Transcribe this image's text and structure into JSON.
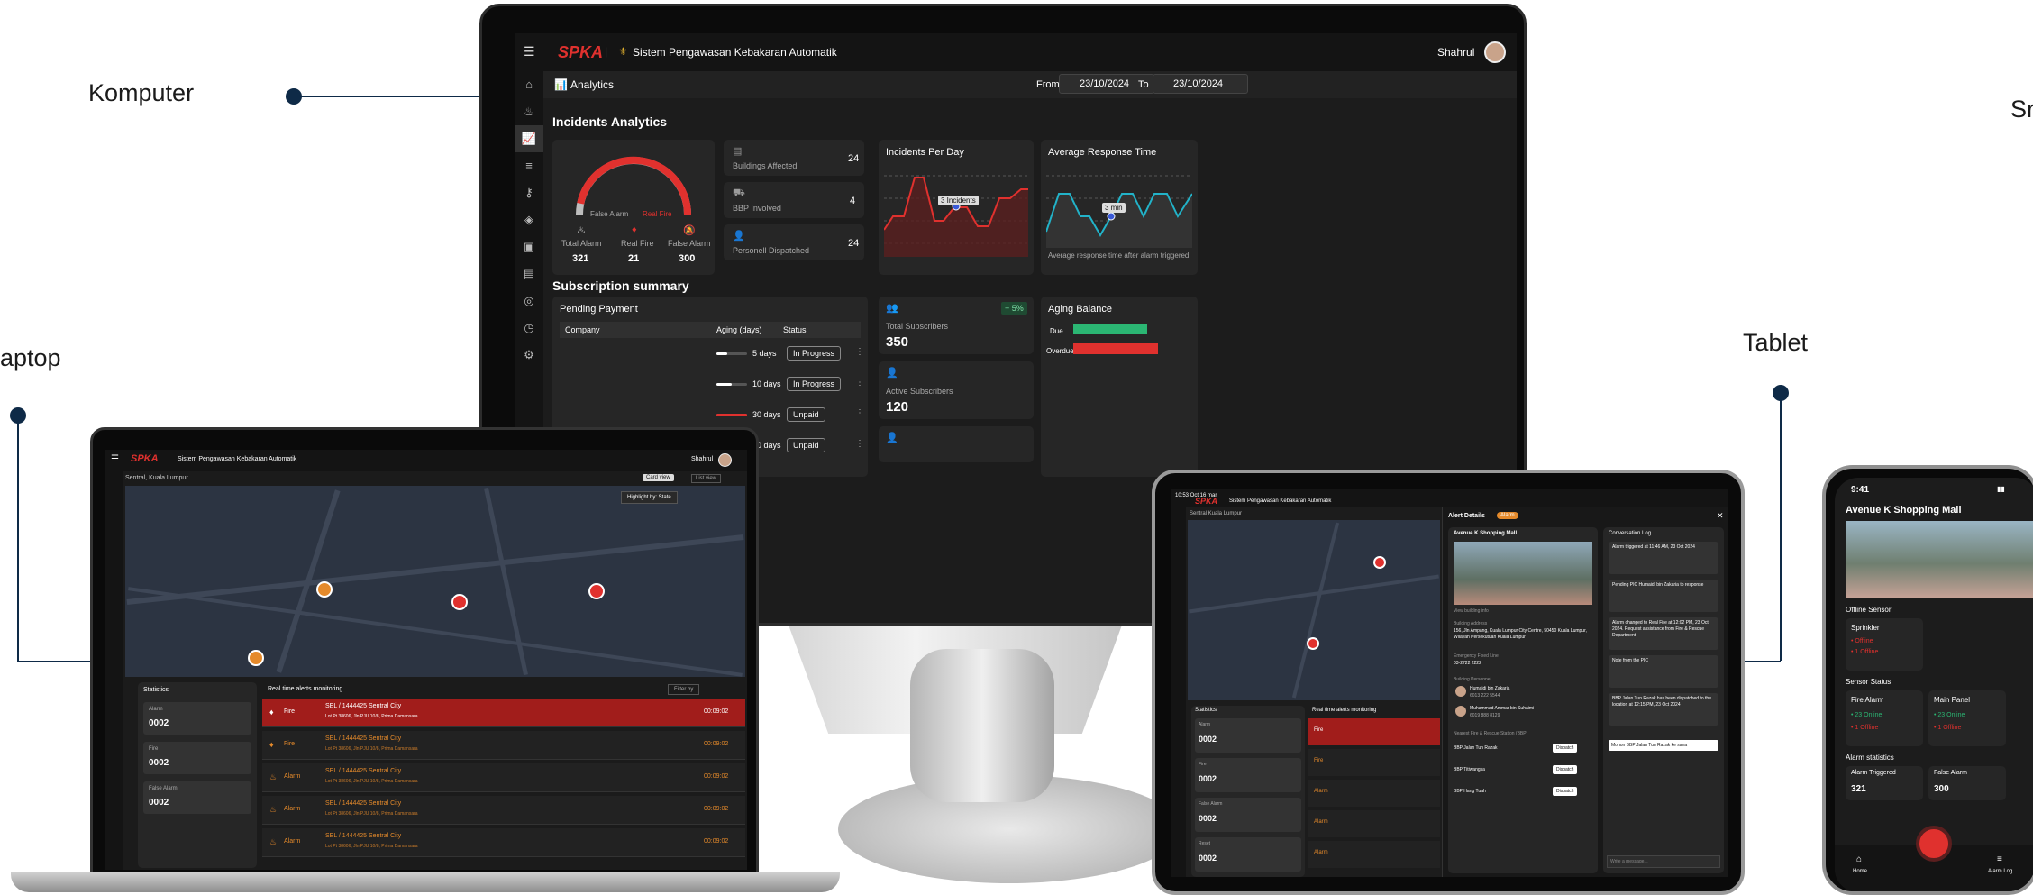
{
  "labels": {
    "komputer": "Komputer",
    "laptop": "aptop",
    "tablet": "Tablet",
    "smartphone": "Sr"
  },
  "colors": {
    "accent": "#e0312e",
    "navy": "#0e2a47",
    "green": "#2bb673",
    "cyan": "#22b3c9"
  },
  "app": {
    "logo": "SPKA",
    "title": "Sistem Pengawasan Kebakaran Automatik",
    "user": "Shahrul"
  },
  "desktop": {
    "breadcrumb": "Analytics",
    "from_label": "From",
    "from_value": "23/10/2024",
    "to_label": "To",
    "to_value": "23/10/2024",
    "section_title": "Incidents Analytics",
    "gauge": {
      "legend_false": "False Alarm",
      "legend_real": "Real Fire",
      "total_label": "Total Alarm",
      "total": "321",
      "real_label": "Real Fire",
      "real": "21",
      "false_label": "False Alarm",
      "false": "300",
      "real_fraction": 0.065
    },
    "kpis": [
      {
        "label": "Buildings Affected",
        "value": "24",
        "icon": "building-icon"
      },
      {
        "label": "BBP Involved",
        "value": "4",
        "icon": "truck-icon"
      },
      {
        "label": "Personell Dispatched",
        "value": "24",
        "icon": "person-icon"
      }
    ],
    "incidents_title": "Incidents Per Day",
    "incidents_tooltip": "3 Incidents",
    "response_title": "Average Response Time",
    "response_tooltip": "3 min",
    "response_note": "Average response time after alarm triggered",
    "subscription_title": "Subscription summary",
    "pending_title": "Pending Payment",
    "table_headers": [
      "Company",
      "Aging (days)",
      "Status"
    ],
    "rows": [
      {
        "aging": "5 days",
        "status": "In Progress",
        "fill": 0.35
      },
      {
        "aging": "10 days",
        "status": "In Progress",
        "fill": 0.5
      },
      {
        "aging": "30 days",
        "status": "Unpaid",
        "fill": 1
      },
      {
        "aging": "30 days",
        "status": "Unpaid",
        "fill": 1
      }
    ],
    "total_subscribers_label": "Total Subscribers",
    "total_subscribers": "350",
    "growth": "+ 5%",
    "active_subscribers_label": "Active Subscribers",
    "active_subscribers": "120",
    "aging_title": "Aging Balance",
    "aging_due": "Due",
    "aging_overdue": "Overdue"
  },
  "laptop": {
    "breadcrumb": "Sentral, Kuala Lumpur",
    "card_view": "Card view",
    "list_view": "List view",
    "highlight": "Highlight by: State",
    "stats_title": "Statistics",
    "stats": [
      {
        "label": "Alarm",
        "value": "0002"
      },
      {
        "label": "Fire",
        "value": "0002"
      },
      {
        "label": "False Alarm",
        "value": "0002"
      }
    ],
    "alerts_title": "Real time alerts monitoring",
    "filter": "Filter by",
    "alerts": [
      {
        "type": "Fire",
        "title": "SEL / 1444425 Sentral City",
        "addr": "Lot Pt 38606, Jln PJU 10/8, Prima Damansara",
        "time": "00:09:02",
        "active": true
      },
      {
        "type": "Fire",
        "title": "SEL / 1444425 Sentral City",
        "addr": "Lot Pt 38606, Jln PJU 10/8, Prima Damansara",
        "time": "00:09:02",
        "active": false
      },
      {
        "type": "Alarm",
        "title": "SEL / 1444425 Sentral City",
        "addr": "Lot Pt 38606, Jln PJU 10/8, Prima Damansara",
        "time": "00:09:02",
        "active": false
      },
      {
        "type": "Alarm",
        "title": "SEL / 1444425 Sentral City",
        "addr": "Lot Pt 38606, Jln PJU 10/8, Prima Damansara",
        "time": "00:09:02",
        "active": false
      },
      {
        "type": "Alarm",
        "title": "SEL / 1444425 Sentral City",
        "addr": "Lot Pt 38606, Jln PJU 10/8, Prima Damansara",
        "time": "00:09:02",
        "active": false
      }
    ]
  },
  "tablet": {
    "status_time": "10:53 Oct 16 mar",
    "breadcrumb": "Sentral Kuala Lumpur",
    "panel_title": "Alert Details",
    "badge": "Alarm",
    "building": "Avenue K Shopping Mall",
    "view_info": "View building info",
    "address_label": "Building Address",
    "address": "156, Jln Ampang, Kuala Lumpur City Centre, 50450 Kuala Lumpur, Wilayah Persekutuan Kuala Lumpur",
    "hotline_label": "Emergency Fixed Line",
    "hotline": "03-2722 2222",
    "personnel_label": "Building Personnel",
    "personnel": [
      {
        "name": "Humaidi bin Zakaria",
        "phone": "6013 222 5544"
      },
      {
        "name": "Muhammad Ammar bin Suhaimi",
        "phone": "6019 888 8129"
      }
    ],
    "nearest_label": "Nearest Fire & Rescue Station (BBP)",
    "dispatch": "Dispatch",
    "stations": [
      "BBP Jalan Tun Razak",
      "BBP Titiwangsa",
      "BBP Hang Tuah"
    ],
    "log_title": "Conversation Log",
    "logs": [
      "Alarm triggered at 11:46 AM, 23 Oct 2024",
      "Pending PIC Humaidi bin Zakaria to response",
      "Alarm changed to Real Fire at 12:02 PM, 23 Oct 2024. Request assistance from Fire & Rescue Department",
      "Note from the PIC",
      "BBP Jalan Tun Razak has been dispatched to the location at 12:15 PM, 23 Oct 2024"
    ],
    "msg_in": "Mohon BBP Jalan Tun Razak ke sana",
    "placeholder": "Write a message...",
    "stats": [
      {
        "label": "Alarm",
        "value": "0002"
      },
      {
        "label": "Fire",
        "value": "0002"
      },
      {
        "label": "False Alarm",
        "value": "0002"
      },
      {
        "label": "Reset",
        "value": "0002"
      }
    ],
    "alerts_title": "Real time alerts monitoring",
    "alerts": [
      "Fire",
      "Fire",
      "Alarm",
      "Alarm",
      "Alarm"
    ]
  },
  "phone": {
    "time": "9:41",
    "title": "Avenue K Shopping Mall",
    "offline_title": "Offline Sensor",
    "sensor": "Sprinkler",
    "sensor_off": "• Offline",
    "sensor_off2": "• 1 Offline",
    "status_title": "Sensor Status",
    "status": [
      {
        "label": "Fire Alarm",
        "online": "• 23 Online",
        "offline": "• 1 Offline"
      },
      {
        "label": "Main Panel",
        "online": "• 23 Online",
        "offline": "• 1 Offline"
      }
    ],
    "alarm_title": "Alarm statistics",
    "triggered_label": "Alarm Triggered",
    "triggered": "321",
    "false_label": "False Alarm",
    "false": "300",
    "nav_home": "Home",
    "nav_log": "Alarm Log"
  }
}
